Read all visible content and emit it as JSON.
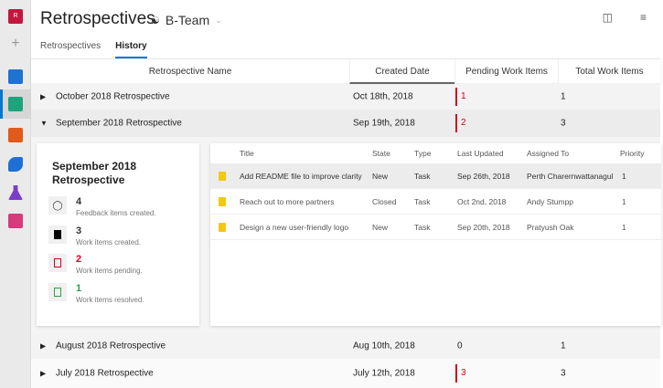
{
  "header": {
    "title": "Retrospectives",
    "team": "B-Team"
  },
  "tabs": [
    {
      "label": "Retrospectives"
    },
    {
      "label": "History"
    }
  ],
  "columns": [
    "Retrospective Name",
    "Created Date",
    "Pending Work Items",
    "Total Work Items"
  ],
  "rows": [
    {
      "name": "October 2018 Retrospective",
      "date": "Oct 18th, 2018",
      "pending": "1",
      "total": "1"
    },
    {
      "name": "September 2018 Retrospective",
      "date": "Sep 19th, 2018",
      "pending": "2",
      "total": "3"
    },
    {
      "name": "August 2018 Retrospective",
      "date": "Aug 10th, 2018",
      "pending": "0",
      "total": "1"
    },
    {
      "name": "July 2018 Retrospective",
      "date": "July 12th, 2018",
      "pending": "3",
      "total": "3"
    }
  ],
  "summary": {
    "title": "September 2018 Retrospective",
    "stats": [
      {
        "value": "4",
        "label": "Feedback items created.",
        "color": "#222"
      },
      {
        "value": "3",
        "label": "Work items created.",
        "color": "#222"
      },
      {
        "value": "2",
        "label": "Work items pending.",
        "color": "#d0021b"
      },
      {
        "value": "1",
        "label": "Work items resolved.",
        "color": "#2e9e4f"
      }
    ]
  },
  "workitems": {
    "columns": [
      "Title",
      "State",
      "Type",
      "Last Updated",
      "Assigned To",
      "Priority"
    ],
    "items": [
      {
        "title": "Add README file to improve clarity",
        "state": "New",
        "type": "Task",
        "updated": "Sep 26th, 2018",
        "assigned": "Perth Charernwattanagul",
        "priority": "1"
      },
      {
        "title": "Reach out to more partners",
        "state": "Closed",
        "type": "Task",
        "updated": "Oct 2nd, 2018",
        "assigned": "Andy Stumpp",
        "priority": "1"
      },
      {
        "title": "Design a new user-friendly logo",
        "state": "New",
        "type": "Task",
        "updated": "Sep 20th, 2018",
        "assigned": "Pratyush Oak",
        "priority": "1"
      }
    ]
  }
}
